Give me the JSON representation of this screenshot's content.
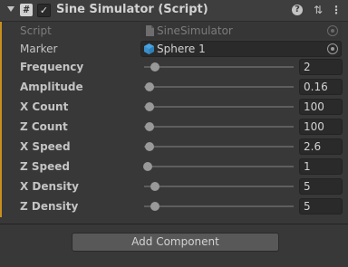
{
  "component": {
    "title": "Sine Simulator (Script)",
    "enabled": true,
    "icons": [
      "script-icon",
      "help-icon",
      "presets-icon",
      "menu-icon"
    ]
  },
  "fields": {
    "script": {
      "label": "Script",
      "value": "SineSimulator",
      "icon": "script-asset-icon"
    },
    "marker": {
      "label": "Marker",
      "value": "Sphere 1",
      "icon": "cube-icon"
    }
  },
  "sliders": [
    {
      "label": "Frequency",
      "value": "2",
      "fraction": 0.05
    },
    {
      "label": "Amplitude",
      "value": "0.16",
      "fraction": 0.01
    },
    {
      "label": "X Count",
      "value": "100",
      "fraction": 0.01
    },
    {
      "label": "Z Count",
      "value": "100",
      "fraction": 0.01
    },
    {
      "label": "X Speed",
      "value": "2.6",
      "fraction": 0.01
    },
    {
      "label": "Z Speed",
      "value": "1",
      "fraction": 0.0
    },
    {
      "label": "X Density",
      "value": "5",
      "fraction": 0.05
    },
    {
      "label": "Z Density",
      "value": "5",
      "fraction": 0.05
    }
  ],
  "footer": {
    "add_component_label": "Add Component"
  },
  "colors": {
    "accent": "#c8901e",
    "background": "#383838",
    "field": "#2a2a2a"
  }
}
